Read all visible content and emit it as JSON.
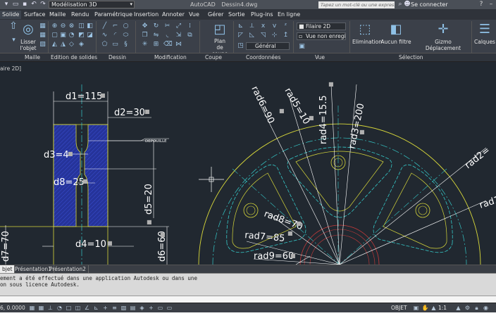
{
  "titlebar": {
    "workspace": "Modélisation 3D",
    "app_title": "AutoCAD",
    "document": "Dessin4.dwg",
    "search_placeholder": "Tapez un mot-clé ou une expression",
    "signin": "Se connecter"
  },
  "menu": {
    "items": [
      "Solide",
      "Surface",
      "Maille",
      "Rendu",
      "Paramétrique",
      "Insertion",
      "Annoter",
      "Vue",
      "Gérer",
      "Sortie",
      "Plug-ins",
      "En ligne"
    ],
    "active": "Solide"
  },
  "ribbon": {
    "smooth_label": "Lisser\nl'objet",
    "plan_label": "Plan\nde coupe",
    "visual_style": "Filaire 2D",
    "view_name": "Vue non enregis",
    "ucs": "Général",
    "elimination": "Elimination",
    "filter": "Aucun filtre",
    "gizmo": "Gizmo Déplacement",
    "layers": "Calques",
    "panels": [
      "Maille",
      "Edition de solides",
      "Dessin",
      "Modification",
      "Coupe",
      "Coordonnées",
      "Vue",
      "Sélection"
    ]
  },
  "viewport_label": "aire 2D]",
  "dimensions": {
    "d1": "d1=115",
    "d2": "d2=30",
    "d3": "d3=4",
    "d4": "d4=10",
    "d5": "d5=20",
    "d6": "d6=60",
    "d7": "d7=70",
    "d8": "d8=25",
    "depouille": "DEPOUILLE",
    "rad2": "rad2=",
    "rad1": "rad1",
    "rad3": "rad3=200",
    "rad4": "rad4=15.5",
    "rad5": "rad5=10",
    "rad6": "rad6=90",
    "rad7": "rad7=85",
    "rad8": "rad8=70",
    "rad9": "rad9=60"
  },
  "layout_tabs": [
    "bjet",
    "Présentation1",
    "Présentation2"
  ],
  "command_lines": [
    "ement a été effectué dans une application Autodesk ou dans une",
    "on sous licence Autodesk."
  ],
  "status": {
    "coords": "6, 0.0000",
    "space": "OBJET",
    "scale": "1:1"
  },
  "colors": {
    "drawing_bg": "#212830",
    "dim_white": "#ffffff",
    "outline_yellow": "#d8d83a",
    "center_cyan": "#35c9c9",
    "hatch_blue": "#2a3ca8",
    "circle_red": "#c83a3a"
  }
}
